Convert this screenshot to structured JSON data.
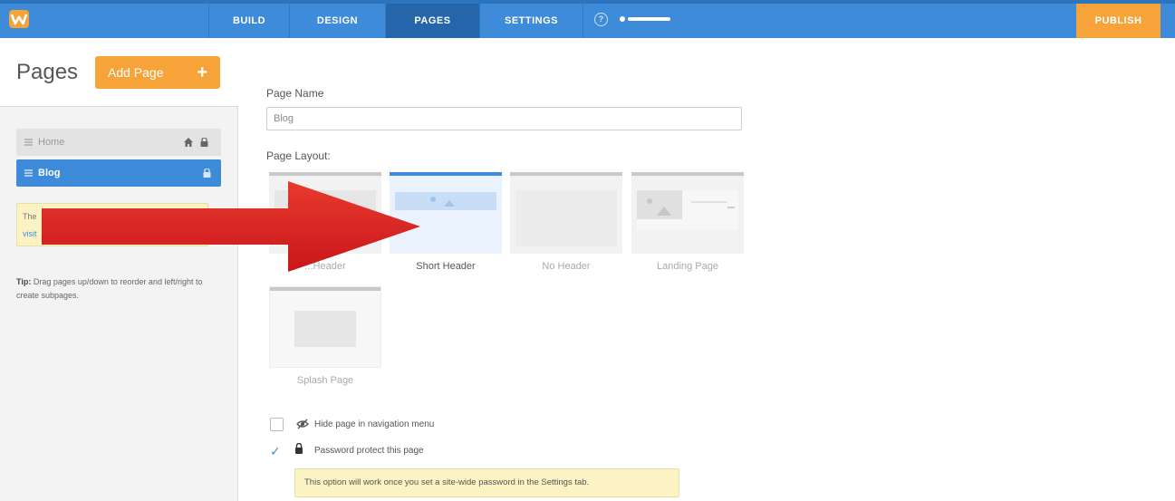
{
  "app": {
    "brand_color": "#3d8bd9",
    "accent_color": "#f6a33a",
    "logo_icon": "weebly-w-logo"
  },
  "nav": {
    "tabs": [
      {
        "label": "BUILD",
        "active": false
      },
      {
        "label": "DESIGN",
        "active": false
      },
      {
        "label": "PAGES",
        "active": true
      },
      {
        "label": "SETTINGS",
        "active": false
      }
    ],
    "help_icon": "?",
    "progress_fraction": 1.0,
    "publish_label": "PUBLISH"
  },
  "sidebar": {
    "title": "Pages",
    "add_page_label": "Add Page",
    "add_page_icon": "+",
    "pages": [
      {
        "label": "Home",
        "selected": false,
        "home": true,
        "locked": true
      },
      {
        "label": "Blog",
        "selected": true,
        "home": false,
        "locked": true
      }
    ],
    "notice_line1": "The",
    "notice_line2": "visit",
    "tip_label": "Tip:",
    "tip_text": "Drag pages up/down to reorder and left/right to create subpages."
  },
  "form": {
    "page_name_label": "Page Name",
    "page_name_value": "Blog",
    "layout_label": "Page Layout:",
    "layouts": [
      {
        "name": "Tall Header",
        "visible_name": "...Header",
        "selected": false
      },
      {
        "name": "Short Header",
        "selected": true
      },
      {
        "name": "No Header",
        "selected": false
      },
      {
        "name": "Landing Page",
        "selected": false
      },
      {
        "name": "Splash Page",
        "selected": false
      }
    ],
    "hide_nav_label": "Hide page in navigation menu",
    "hide_nav_checked": false,
    "password_label": "Password protect this page",
    "password_checked": true,
    "password_notice": "This option will work once you set a site-wide password in the Settings tab."
  }
}
